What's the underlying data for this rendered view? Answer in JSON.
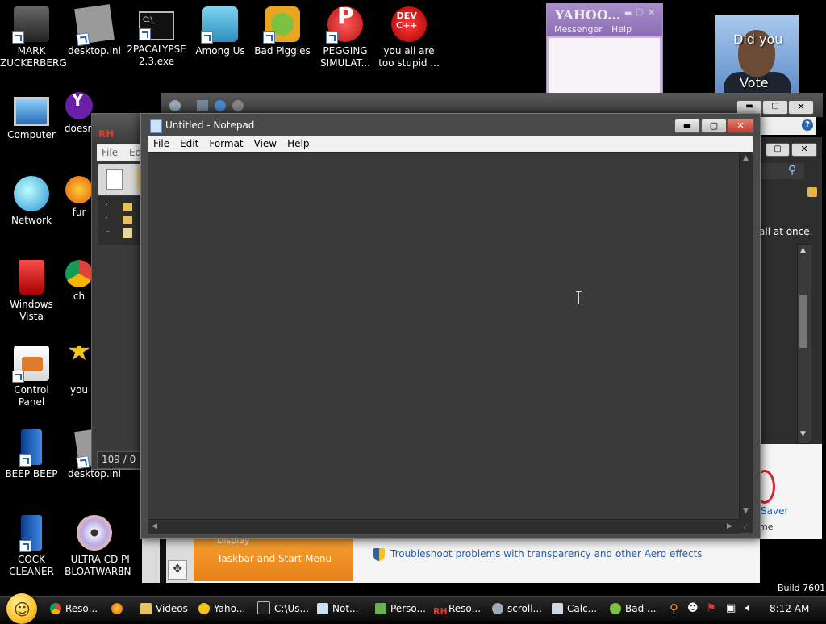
{
  "desktop_icons": [
    {
      "label": "MARK\nZUCKERBERG",
      "icon": "user-folder-icon"
    },
    {
      "label": "desktop.ini",
      "icon": "settings-file-icon"
    },
    {
      "label": "2PACALYPSE\n2.3.exe",
      "icon": "cmd-icon"
    },
    {
      "label": "Among Us",
      "icon": "among-us-icon"
    },
    {
      "label": "Bad Piggies",
      "icon": "bad-piggies-icon"
    },
    {
      "label": "PEGGING\nSIMULAT...",
      "icon": "pegging-icon"
    },
    {
      "label": "you all are\ntoo stupid ...",
      "icon": "dev-cpp-icon"
    },
    {
      "label": "Computer",
      "icon": "computer-icon"
    },
    {
      "label": "doesn",
      "icon": "yahoo-icon"
    },
    {
      "label": "Network",
      "icon": "network-icon"
    },
    {
      "label": "fur",
      "icon": "firefox-icon"
    },
    {
      "label": "Windows\nVista",
      "icon": "recycle-bin-icon"
    },
    {
      "label": "ch",
      "icon": "chrome-icon"
    },
    {
      "label": "Control Panel",
      "icon": "control-panel-icon"
    },
    {
      "label": "you",
      "icon": "star-icon"
    },
    {
      "label": "BEEP BEEP",
      "icon": "beep-icon"
    },
    {
      "label": "desktop.ini",
      "icon": "settings-file-icon"
    },
    {
      "label": "COCK\nCLEANER",
      "icon": "cleaner-icon"
    },
    {
      "label": "ULTRA CD\nBLOATWARE",
      "icon": "cd-icon"
    },
    {
      "label": "PI\nIN",
      "icon": "partial-icon"
    }
  ],
  "notepad": {
    "title": "Untitled - Notepad",
    "menu": [
      "File",
      "Edit",
      "Format",
      "View",
      "Help"
    ],
    "content": ""
  },
  "explorer": {
    "menu_file": "File",
    "menu_edit": "Edi",
    "status": "109 / 0"
  },
  "yahoo": {
    "brand": "YAHOO...",
    "menu_messenger": "Messenger",
    "menu_help": "Help"
  },
  "gadget": {
    "line1": "Did you",
    "line2": "Vote"
  },
  "personalization": {
    "side_link_1": "Display",
    "side_link_2": "Taskbar and Start Menu",
    "troubleshoot": "Troubleshoot problems with transparency and other Aero effects",
    "right_text": "all at once.",
    "saver_text": "Saver",
    "me_text": "me",
    "build": "Build 7601"
  },
  "taskbar": {
    "items": [
      {
        "label": "Reso...",
        "icon": "chrome-icon"
      },
      {
        "label": "",
        "icon": "firefox-icon"
      },
      {
        "label": "Videos",
        "icon": "folder-icon"
      },
      {
        "label": "Yaho...",
        "icon": "yahoo-icon"
      },
      {
        "label": "C:\\Us...",
        "icon": "cmd-icon"
      },
      {
        "label": "Not...",
        "icon": "notepad-icon"
      },
      {
        "label": "Perso...",
        "icon": "personalize-icon"
      },
      {
        "label": "Reso...",
        "icon": "rh-icon"
      },
      {
        "label": "scroll...",
        "icon": "paint-icon"
      },
      {
        "label": "Calc...",
        "icon": "calculator-icon"
      },
      {
        "label": "Bad ...",
        "icon": "bad-piggies-icon"
      }
    ],
    "clock": "8:12 AM"
  },
  "colors": {
    "accent_orange": "#f39322",
    "close_red": "#c0392b",
    "link_blue": "#1e5ebd"
  }
}
